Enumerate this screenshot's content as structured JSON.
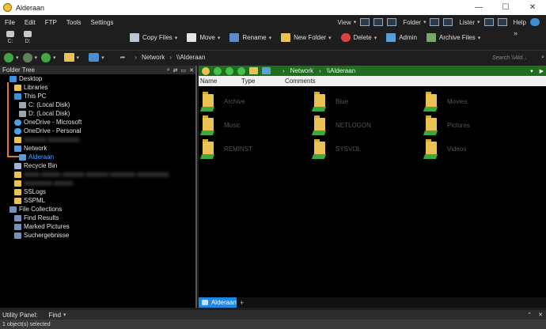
{
  "window": {
    "title": "Alderaan",
    "minimize": "—",
    "maximize": "☐",
    "close": "✕"
  },
  "menu": {
    "items": [
      "File",
      "Edit",
      "FTP",
      "Tools",
      "Settings"
    ],
    "view_label": "View",
    "folder_label": "Folder",
    "lister_label": "Lister",
    "help_label": "Help"
  },
  "drives": [
    {
      "label": "C:"
    },
    {
      "label": "D:"
    }
  ],
  "toolbar": {
    "actions": [
      {
        "label": "Copy Files",
        "icon": "copy-files-icon",
        "dropdown": true
      },
      {
        "label": "Move",
        "icon": "move-icon",
        "dropdown": true
      },
      {
        "label": "Rename",
        "icon": "rename-icon",
        "dropdown": true
      },
      {
        "label": "New Folder",
        "icon": "new-folder-icon",
        "dropdown": true
      },
      {
        "label": "Delete",
        "icon": "delete-icon",
        "dropdown": true
      },
      {
        "label": "Admin",
        "icon": "admin-icon",
        "dropdown": false
      },
      {
        "label": "Archive Files",
        "icon": "archive-icon",
        "dropdown": true
      }
    ],
    "more": "»"
  },
  "address": {
    "crumbs": [
      "Network",
      "\\\\Alderaan"
    ],
    "search_placeholder": "Search \\\\Ald..."
  },
  "folder_tree": {
    "title": "Folder Tree",
    "items": [
      {
        "label": "Desktop",
        "icon": "desktop-icon"
      },
      {
        "label": "Libraries",
        "icon": "folder-icon"
      },
      {
        "label": "This PC",
        "icon": "computer-icon"
      },
      {
        "label": "C: (Local Disk)",
        "icon": "drive-icon"
      },
      {
        "label": "D: (Local Disk)",
        "icon": "drive-icon"
      },
      {
        "label": "OneDrive - Microsoft",
        "icon": "cloud-icon"
      },
      {
        "label": "OneDrive - Personal",
        "icon": "cloud-icon"
      },
      {
        "label": "Network",
        "icon": "network-icon"
      },
      {
        "label": "Alderaan",
        "icon": "network-share-icon",
        "selected": true
      },
      {
        "label": "Recycle Bin",
        "icon": "recycle-bin-icon"
      },
      {
        "label": "SSLogs",
        "icon": "folder-icon"
      },
      {
        "label": "SSPML",
        "icon": "folder-icon"
      },
      {
        "label": "File Collections",
        "icon": "collections-icon"
      },
      {
        "label": "Find Results",
        "icon": "collections-icon"
      },
      {
        "label": "Marked Pictures",
        "icon": "collections-icon"
      },
      {
        "label": "Suchergebnisse",
        "icon": "collections-icon"
      }
    ]
  },
  "file_pane": {
    "crumbs": [
      "Network",
      "\\\\Alderaan"
    ],
    "columns": [
      "Name",
      "Type",
      "Comments"
    ],
    "items": [
      {
        "name": "Archive"
      },
      {
        "name": "Blue"
      },
      {
        "name": "Movies"
      },
      {
        "name": "Music"
      },
      {
        "name": "NETLOGON"
      },
      {
        "name": "Pictures"
      },
      {
        "name": "REMINST"
      },
      {
        "name": "SYSVOL"
      },
      {
        "name": "Videos"
      }
    ],
    "tab_label": "Alderaan",
    "add_tab": "+"
  },
  "utility": {
    "label": "Utility Panel:",
    "value": "Find"
  },
  "status": {
    "text": "1 object(s) selected"
  },
  "colors": {
    "accent": "#1e88e5",
    "pathbar": "#1f6e1f",
    "tree_line": "#e07a1e",
    "selected_text": "#4aa8ff"
  }
}
